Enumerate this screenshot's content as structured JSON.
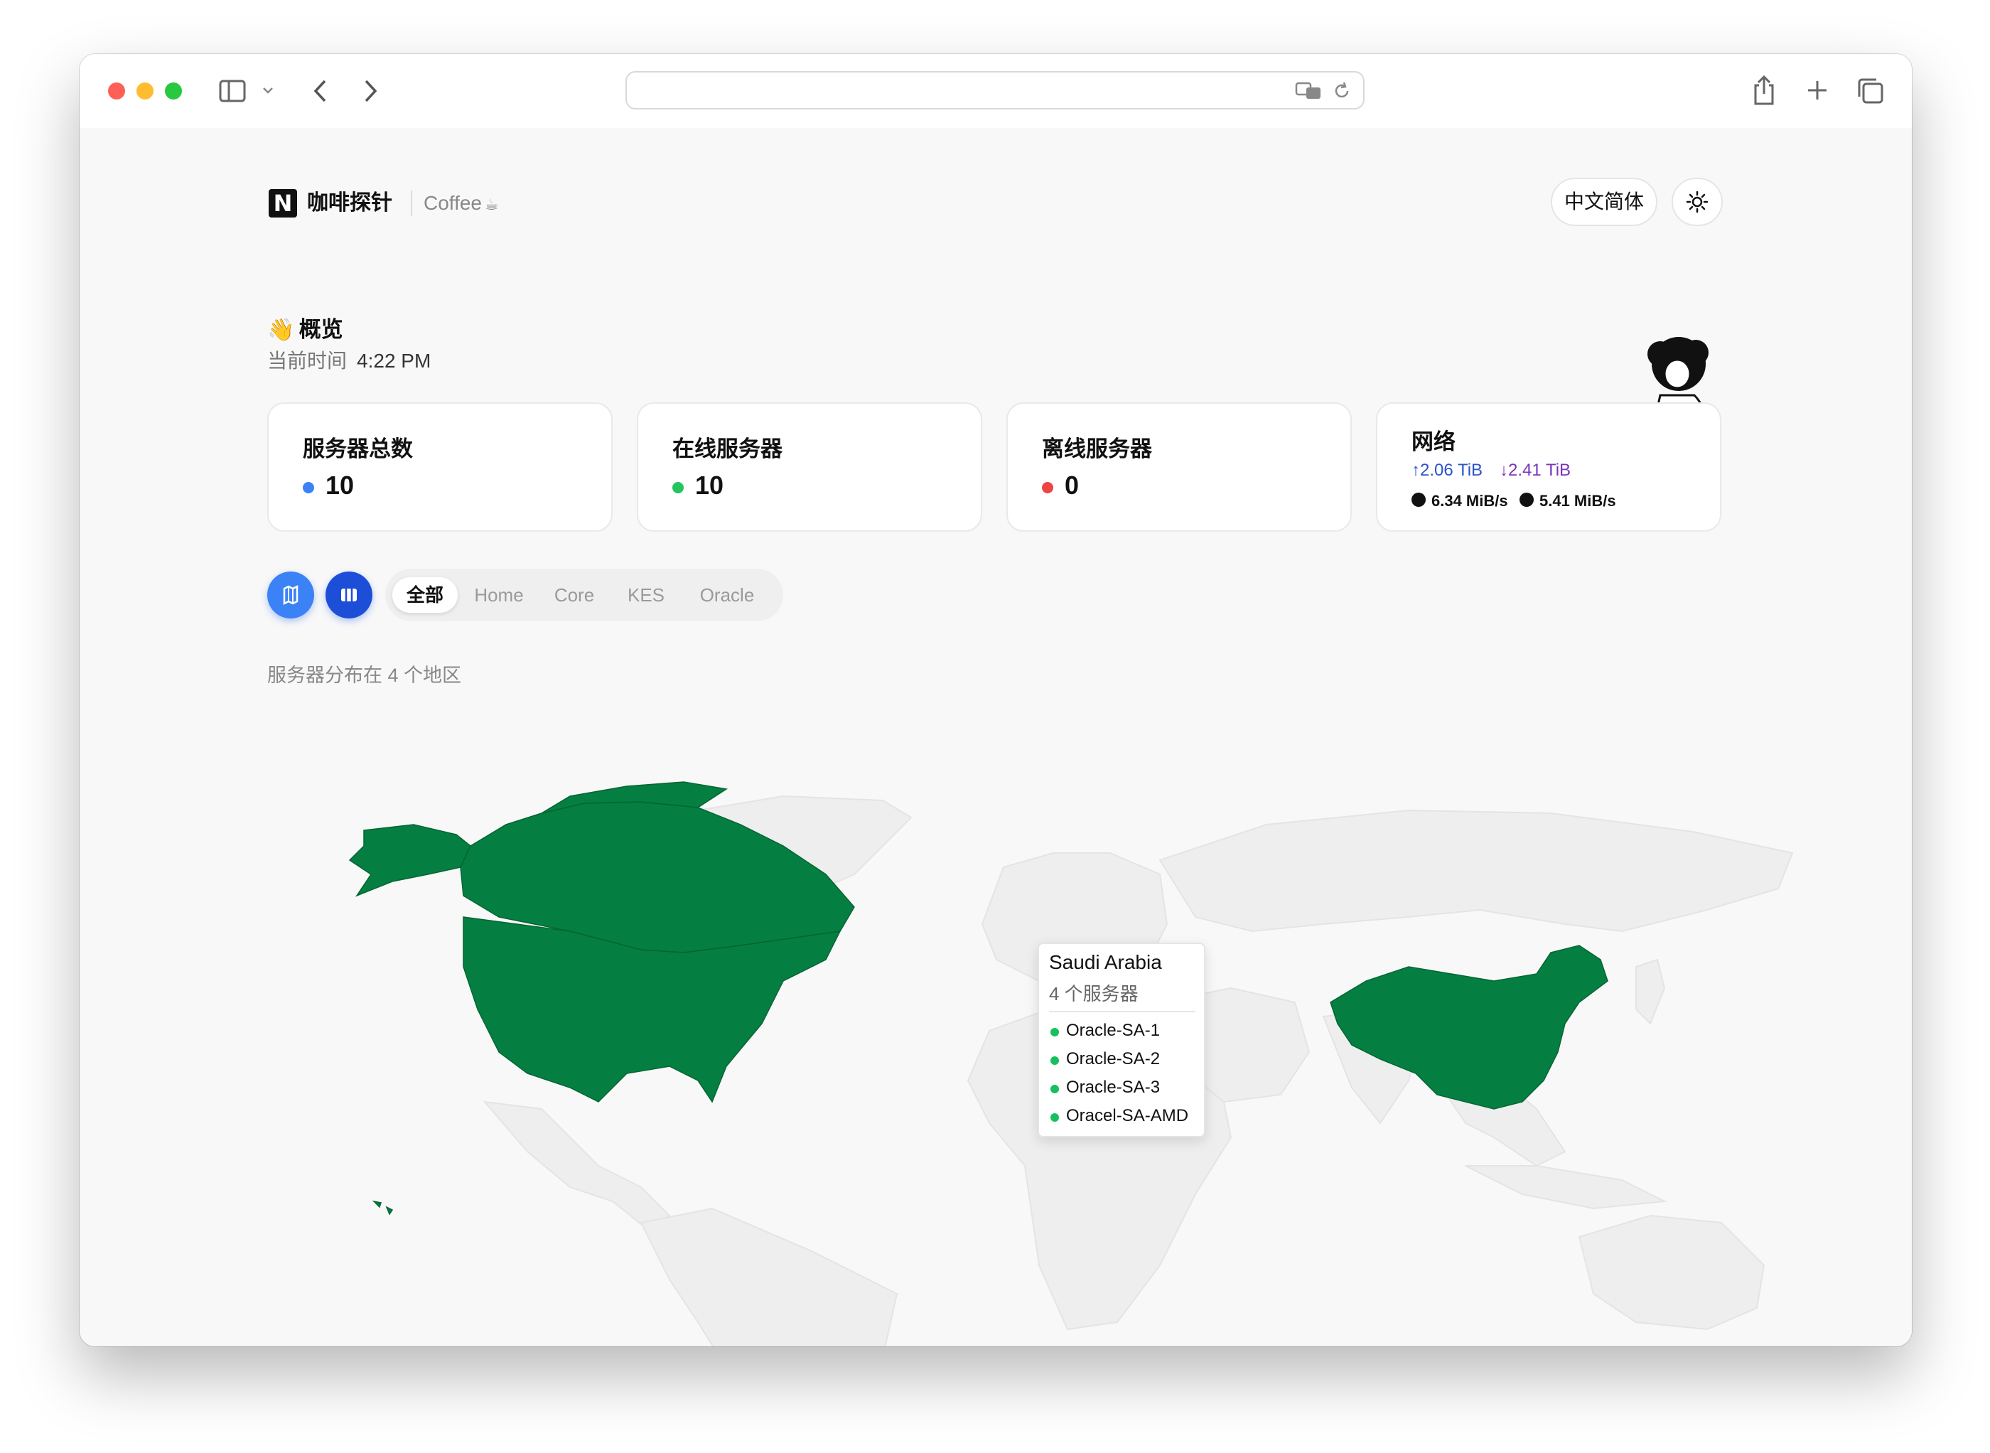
{
  "brand": {
    "logo_letter": "N",
    "name": "咖啡探针",
    "subtitle": "Coffee"
  },
  "header": {
    "language_label": "中文简体",
    "theme_icon": "sun-icon"
  },
  "overview": {
    "title": "概览",
    "time_label": "当前时间",
    "time_value": "4:22 PM"
  },
  "cards": [
    {
      "title": "服务器总数",
      "value": "10",
      "dot_color": "#3b82f6"
    },
    {
      "title": "在线服务器",
      "value": "10",
      "dot_color": "#22c55e"
    },
    {
      "title": "离线服务器",
      "value": "0",
      "dot_color": "#ef4444"
    }
  ],
  "network": {
    "title": "网络",
    "upload_total": "↑2.06 TiB",
    "download_total": "↓2.41 TiB",
    "upload_speed": "6.34 MiB/s",
    "download_speed": "5.41 MiB/s"
  },
  "view_buttons": [
    {
      "name": "map-view",
      "icon": "map-icon",
      "color": "#3b82f6"
    },
    {
      "name": "grid-view",
      "icon": "columns-icon",
      "color": "#1d4ed8"
    }
  ],
  "tabs": [
    {
      "label": "全部",
      "active": true
    },
    {
      "label": "Home",
      "active": false
    },
    {
      "label": "Core",
      "active": false
    },
    {
      "label": "KES",
      "active": false
    },
    {
      "label": "Oracle",
      "active": false
    }
  ],
  "map": {
    "summary": "服务器分布在 4 个地区",
    "highlight_color": "#047f41",
    "base_color": "#eeeeee",
    "tooltip": {
      "country": "Saudi Arabia",
      "count_label": "4 个服务器",
      "servers": [
        "Oracle-SA-1",
        "Oracle-SA-2",
        "Oracle-SA-3",
        "Oracel-SA-AMD"
      ]
    }
  }
}
